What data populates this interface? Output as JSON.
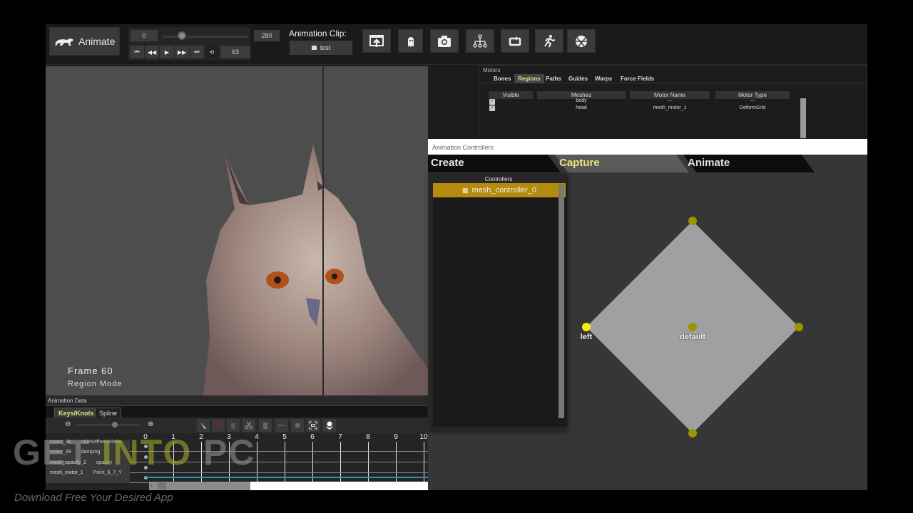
{
  "toolbar": {
    "app_button_label": "Animate",
    "range_start": "0",
    "range_end": "280",
    "current_frame": "63",
    "playhead_fraction": 0.225,
    "transport_buttons": [
      "skip-start",
      "rewind",
      "play",
      "fast-forward",
      "skip-end",
      "loop"
    ],
    "clip_label": "Animation Clip:",
    "clip_value": "test",
    "tool_icons": [
      "export-icon",
      "ghost-icon",
      "camera-icon",
      "hierarchy-icon",
      "loop-icon",
      "running-figure-icon",
      "physics-ball-icon"
    ]
  },
  "viewport": {
    "frame_label": "Frame 60",
    "mode_label": "Region Mode"
  },
  "animation_data": {
    "title": "Animation Data",
    "tabs": [
      {
        "label": "Keys/Knots",
        "active": true
      },
      {
        "label": "Spline",
        "active": false
      }
    ],
    "zoom_fraction": 0.6,
    "key_tools": [
      "brush-icon",
      "delete-key-icon",
      "trash-icon",
      "cut-icon",
      "paste-icon",
      "spread-icon",
      "dot-icon",
      "frame-selection-icon",
      "marker-icon"
    ],
    "ticks": [
      "0",
      "1",
      "2",
      "3",
      "4",
      "5",
      "6",
      "7",
      "8",
      "9",
      "10"
    ],
    "rows": [
      {
        "motor": "motor_28",
        "property": "radeStiffnessRatio"
      },
      {
        "motor": "motor_28",
        "property": "damping"
      },
      {
        "motor": "mesh_opacity_2",
        "property": "opacity"
      },
      {
        "motor": "mesh_motor_1",
        "property": "Point_6_7_Y"
      }
    ]
  },
  "motors": {
    "title": "Motors",
    "tabs": [
      {
        "label": "Bones",
        "active": false
      },
      {
        "label": "Regions",
        "active": true
      },
      {
        "label": "Paths",
        "active": false
      },
      {
        "label": "Guides",
        "active": false
      },
      {
        "label": "Warps",
        "active": false
      },
      {
        "label": "Force Fields",
        "active": false
      }
    ],
    "columns": [
      "Visible",
      "Meshes",
      "Motor Name",
      "Motor Type"
    ],
    "rows": [
      {
        "visible": true,
        "mesh": "body",
        "motor_name": "—",
        "motor_type": "—"
      },
      {
        "visible": true,
        "mesh": "head",
        "motor_name": "mesh_motor_1",
        "motor_type": "DeformGrid"
      }
    ]
  },
  "animation_controllers": {
    "title": "Animation Controllers",
    "tabs": [
      {
        "label": "Create",
        "active": false
      },
      {
        "label": "Capture",
        "active": true
      },
      {
        "label": "Animate",
        "active": false
      }
    ],
    "controllers_title": "Controllers",
    "controllers": [
      "mesh_controller_0"
    ],
    "points": [
      {
        "name": "top",
        "label": ""
      },
      {
        "name": "left",
        "label": "left",
        "selected": true
      },
      {
        "name": "center",
        "label": "default"
      },
      {
        "name": "right",
        "label": ""
      },
      {
        "name": "bottom",
        "label": ""
      }
    ],
    "colors": {
      "selected_point": "#f5f000",
      "point": "#9a9500",
      "shape": "#a0a0a0",
      "controller_highlight": "#b58a0d"
    }
  },
  "watermark": {
    "part1": "GET ",
    "part2": "INTO",
    "part3": " PC",
    "subtitle": "Download Free Your Desired App"
  }
}
